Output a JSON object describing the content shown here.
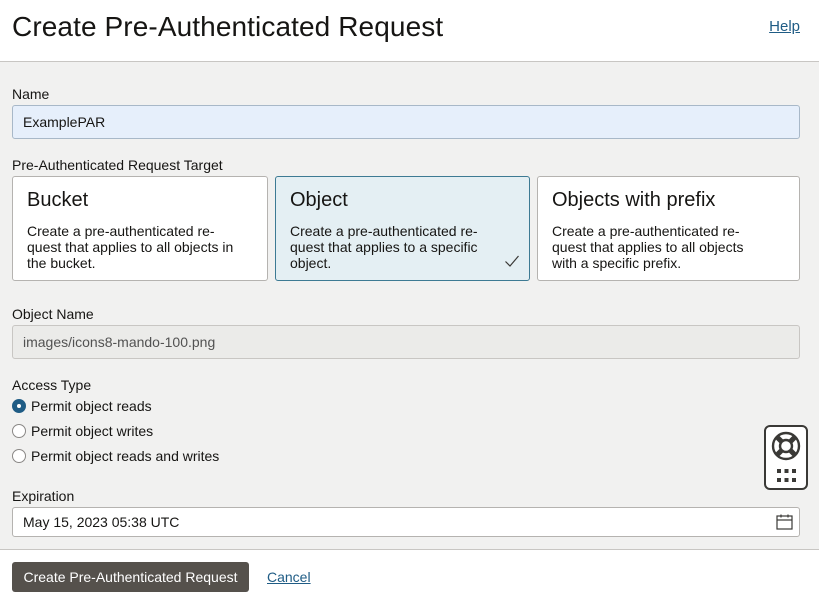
{
  "header": {
    "title": "Create Pre-Authenticated Request",
    "help_label": "Help"
  },
  "name_field": {
    "label": "Name",
    "value": "ExamplePAR"
  },
  "target": {
    "label": "Pre-Authenticated Request Target",
    "selected": "Object",
    "options": [
      {
        "title": "Bucket",
        "description_lines": [
          "Create a pre-authenticated re-",
          "quest that applies to all objects in",
          "the bucket."
        ]
      },
      {
        "title": "Object",
        "description_lines": [
          "Create a pre-authenticated re-",
          "quest that applies to a specific",
          "object."
        ]
      },
      {
        "title": "Objects with prefix",
        "description_lines": [
          "Create a pre-authenticated re-",
          "quest that applies to all objects",
          "with a specific prefix."
        ]
      }
    ]
  },
  "object_name": {
    "label": "Object Name",
    "value": "images/icons8-mando-100.png"
  },
  "access_type": {
    "label": "Access Type",
    "selected": "Permit object reads",
    "options": [
      "Permit object reads",
      "Permit object writes",
      "Permit object reads and writes"
    ]
  },
  "expiration": {
    "label": "Expiration",
    "value": "May 15, 2023 05:38 UTC",
    "icon": "calendar-icon"
  },
  "footer": {
    "primary_label": "Create Pre-Authenticated Request",
    "cancel_label": "Cancel"
  },
  "helper_widget": {
    "icons": [
      "lifebuoy-icon",
      "grid-icon"
    ]
  },
  "colors": {
    "accent": "#1f5c85",
    "selected_card_bg": "#e4eff3",
    "primary_button": "#55514c",
    "page_bg": "#f1f1f0"
  }
}
